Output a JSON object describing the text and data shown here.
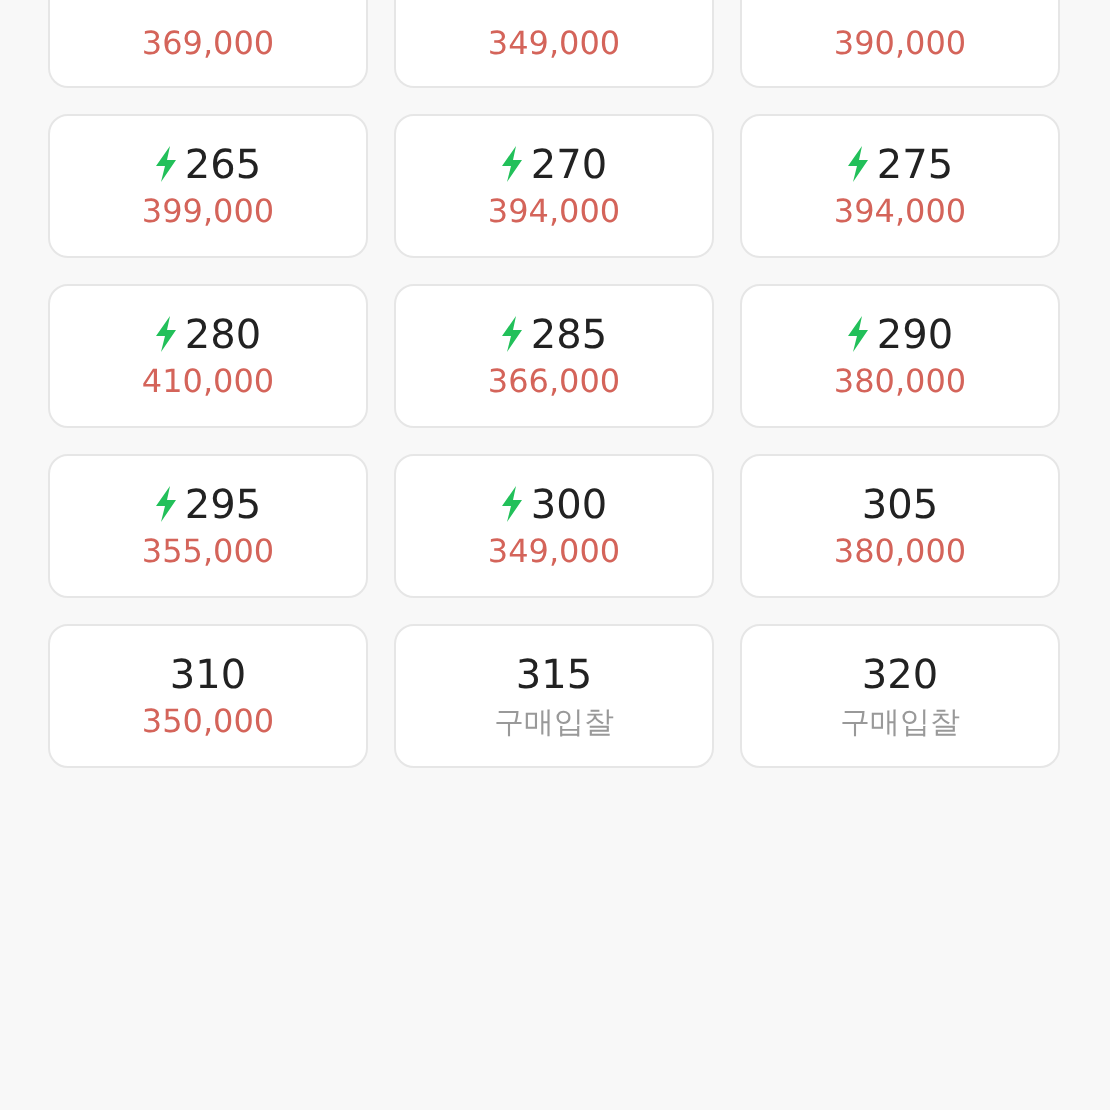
{
  "sizes": [
    {
      "price": "369,000",
      "kind": "price"
    },
    {
      "price": "349,000",
      "kind": "price"
    },
    {
      "price": "390,000",
      "kind": "price"
    },
    {
      "size": "265",
      "quick": true,
      "price": "399,000",
      "kind": "price"
    },
    {
      "size": "270",
      "quick": true,
      "price": "394,000",
      "kind": "price"
    },
    {
      "size": "275",
      "quick": true,
      "price": "394,000",
      "kind": "price"
    },
    {
      "size": "280",
      "quick": true,
      "price": "410,000",
      "kind": "price"
    },
    {
      "size": "285",
      "quick": true,
      "price": "366,000",
      "kind": "price"
    },
    {
      "size": "290",
      "quick": true,
      "price": "380,000",
      "kind": "price"
    },
    {
      "size": "295",
      "quick": true,
      "price": "355,000",
      "kind": "price"
    },
    {
      "size": "300",
      "quick": true,
      "price": "349,000",
      "kind": "price"
    },
    {
      "size": "305",
      "quick": false,
      "price": "380,000",
      "kind": "price"
    },
    {
      "size": "310",
      "quick": false,
      "price": "350,000",
      "kind": "price"
    },
    {
      "size": "315",
      "quick": false,
      "price": "구매입찰",
      "kind": "bid"
    },
    {
      "size": "320",
      "quick": false,
      "price": "구매입찰",
      "kind": "bid"
    }
  ]
}
